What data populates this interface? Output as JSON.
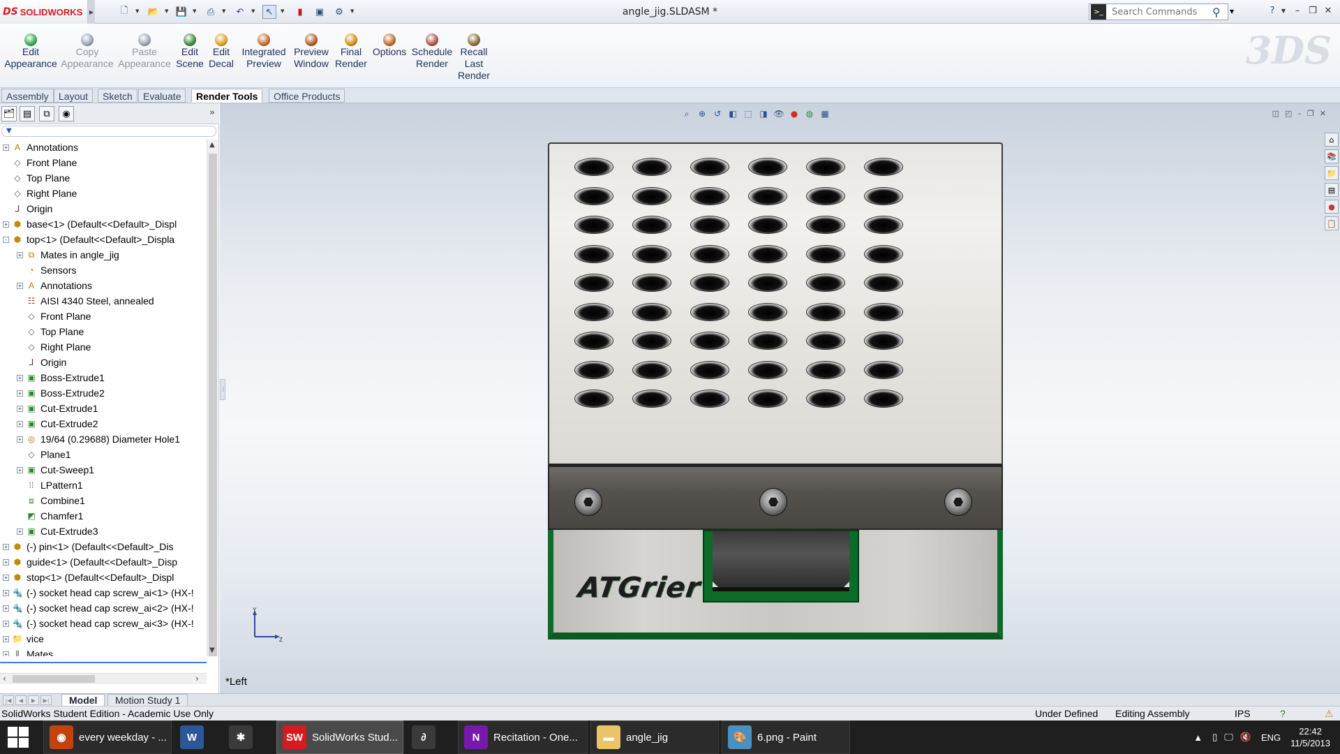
{
  "app": {
    "logo_text": "SOLIDWORKS",
    "logo_mark": "DS",
    "doc_title": "angle_jig.SLDASM *"
  },
  "search": {
    "placeholder": "Search Commands"
  },
  "toolbar": [
    {
      "label": "Edit\nAppearance",
      "icon": "edit-appearance-icon",
      "color": "#2ea84a",
      "enabled": true
    },
    {
      "label": "Copy\nAppearance",
      "icon": "copy-appearance-icon",
      "color": "#9aa3b1",
      "enabled": false
    },
    {
      "label": "Paste\nAppearance",
      "icon": "paste-appearance-icon",
      "color": "#9aa3b1",
      "enabled": false
    },
    {
      "label": "Edit\nScene",
      "icon": "edit-scene-icon",
      "color": "#3a8a3a",
      "enabled": true
    },
    {
      "label": "Edit\nDecal",
      "icon": "edit-decal-icon",
      "color": "#e0a020",
      "enabled": true
    },
    {
      "label": "Integrated\nPreview",
      "icon": "integrated-preview-icon",
      "color": "#c26a2a",
      "enabled": true
    },
    {
      "label": "Preview\nWindow",
      "icon": "preview-window-icon",
      "color": "#b05a20",
      "enabled": true
    },
    {
      "label": "Final\nRender",
      "icon": "final-render-icon",
      "color": "#d88a10",
      "enabled": true
    },
    {
      "label": "Options",
      "icon": "options-icon",
      "color": "#c0692a",
      "enabled": true
    },
    {
      "label": "Schedule\nRender",
      "icon": "schedule-render-icon",
      "color": "#b0504a",
      "enabled": true
    },
    {
      "label": "Recall\nLast\nRender",
      "icon": "recall-last-render-icon",
      "color": "#8a6a30",
      "enabled": true
    }
  ],
  "cm_tabs": [
    "Assembly",
    "Layout",
    "Sketch",
    "Evaluate",
    "Render Tools",
    "Office Products"
  ],
  "cm_active_tab": "Render Tools",
  "tree": [
    {
      "label": "Annotations",
      "level": 0,
      "exp": "+",
      "icon": "annotations-icon"
    },
    {
      "label": "Front Plane",
      "level": 0,
      "exp": "",
      "icon": "plane-icon"
    },
    {
      "label": "Top Plane",
      "level": 0,
      "exp": "",
      "icon": "plane-icon"
    },
    {
      "label": "Right Plane",
      "level": 0,
      "exp": "",
      "icon": "plane-icon"
    },
    {
      "label": "Origin",
      "level": 0,
      "exp": "",
      "icon": "origin-icon"
    },
    {
      "label": "base<1> (Default<<Default>_Displ",
      "level": 0,
      "exp": "+",
      "icon": "part-icon"
    },
    {
      "label": "top<1> (Default<<Default>_Displa",
      "level": 0,
      "exp": "-",
      "icon": "part-icon"
    },
    {
      "label": "Mates in angle_jig",
      "level": 1,
      "exp": "+",
      "icon": "mates-folder-icon"
    },
    {
      "label": "Sensors",
      "level": 1,
      "exp": "",
      "icon": "sensors-icon"
    },
    {
      "label": "Annotations",
      "level": 1,
      "exp": "+",
      "icon": "annotations-icon"
    },
    {
      "label": "AISI 4340 Steel, annealed",
      "level": 1,
      "exp": "",
      "icon": "material-icon"
    },
    {
      "label": "Front Plane",
      "level": 1,
      "exp": "",
      "icon": "plane-icon"
    },
    {
      "label": "Top Plane",
      "level": 1,
      "exp": "",
      "icon": "plane-icon"
    },
    {
      "label": "Right Plane",
      "level": 1,
      "exp": "",
      "icon": "plane-icon"
    },
    {
      "label": "Origin",
      "level": 1,
      "exp": "",
      "icon": "origin-icon"
    },
    {
      "label": "Boss-Extrude1",
      "level": 1,
      "exp": "+",
      "icon": "extrude-icon"
    },
    {
      "label": "Boss-Extrude2",
      "level": 1,
      "exp": "+",
      "icon": "extrude-icon"
    },
    {
      "label": "Cut-Extrude1",
      "level": 1,
      "exp": "+",
      "icon": "cut-icon"
    },
    {
      "label": "Cut-Extrude2",
      "level": 1,
      "exp": "+",
      "icon": "cut-icon"
    },
    {
      "label": "19/64 (0.29688) Diameter Hole1",
      "level": 1,
      "exp": "+",
      "icon": "hole-icon"
    },
    {
      "label": "Plane1",
      "level": 1,
      "exp": "",
      "icon": "plane-icon"
    },
    {
      "label": "Cut-Sweep1",
      "level": 1,
      "exp": "+",
      "icon": "sweep-icon"
    },
    {
      "label": "LPattern1",
      "level": 1,
      "exp": "",
      "icon": "pattern-icon"
    },
    {
      "label": "Combine1",
      "level": 1,
      "exp": "",
      "icon": "combine-icon"
    },
    {
      "label": "Chamfer1",
      "level": 1,
      "exp": "",
      "icon": "chamfer-icon"
    },
    {
      "label": "Cut-Extrude3",
      "level": 1,
      "exp": "+",
      "icon": "cut-icon"
    },
    {
      "label": "(-) pin<1> (Default<<Default>_Dis",
      "level": 0,
      "exp": "+",
      "icon": "part-icon"
    },
    {
      "label": "guide<1> (Default<<Default>_Disp",
      "level": 0,
      "exp": "+",
      "icon": "part-icon"
    },
    {
      "label": "stop<1> (Default<<Default>_Displ",
      "level": 0,
      "exp": "+",
      "icon": "part-icon"
    },
    {
      "label": "(-) socket head cap screw_ai<1> (HX-!",
      "level": 0,
      "exp": "+",
      "icon": "screw-part-icon"
    },
    {
      "label": "(-) socket head cap screw_ai<2> (HX-!",
      "level": 0,
      "exp": "+",
      "icon": "screw-part-icon"
    },
    {
      "label": "(-) socket head cap screw_ai<3> (HX-!",
      "level": 0,
      "exp": "+",
      "icon": "screw-part-icon"
    },
    {
      "label": "vice",
      "level": 0,
      "exp": "+",
      "icon": "folder-icon"
    },
    {
      "label": "Mates",
      "level": 0,
      "exp": "+",
      "icon": "mates-icon"
    }
  ],
  "viewport": {
    "view_name": "*Left",
    "brand_text": "ATGrier",
    "hole_rows": 9,
    "hole_cols": 6,
    "screw_count": 3,
    "triad": {
      "y": "Y",
      "z": "Z"
    }
  },
  "bottom_tabs": [
    "Model",
    "Motion Study 1"
  ],
  "bottom_active": "Model",
  "status": {
    "edition": "SolidWorks Student Edition - Academic Use Only",
    "defined": "Under Defined",
    "mode": "Editing Assembly",
    "units": "IPS"
  },
  "taskbar": {
    "items": [
      {
        "label": "every weekday - ...",
        "icon": "firefox-icon",
        "color": "#c1440e"
      },
      {
        "label": "",
        "icon": "word-icon",
        "color": "#2b579a"
      },
      {
        "label": "",
        "icon": "3dsmax-icon",
        "color": "#3a3a3a"
      },
      {
        "label": "SolidWorks Stud...",
        "icon": "solidworks-icon",
        "color": "#d71920"
      },
      {
        "label": "",
        "icon": "ds-app-icon",
        "color": "#3a3a3a"
      },
      {
        "label": "Recitation - One...",
        "icon": "onenote-icon",
        "color": "#7719aa"
      },
      {
        "label": "angle_jig",
        "icon": "folder-icon",
        "color": "#e9c46a"
      },
      {
        "label": "6.png - Paint",
        "icon": "paint-icon",
        "color": "#4a90c0"
      }
    ],
    "language": "ENG",
    "time": "22:42",
    "date": "11/5/2013"
  }
}
